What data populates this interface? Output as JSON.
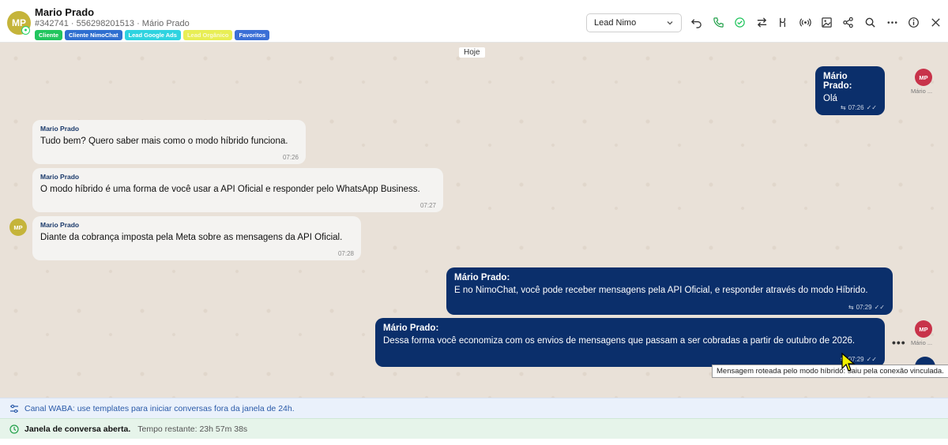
{
  "contact": {
    "initials": "MP",
    "name": "Mario Prado",
    "subtitle": "#342741 · 556298201513 · Mário Prado",
    "tags": [
      {
        "label": "Cliente",
        "color": "#22c55e"
      },
      {
        "label": "Cliente NimoChat",
        "color": "#2f6fd0"
      },
      {
        "label": "Lead Google Ads",
        "color": "#2fd3e0"
      },
      {
        "label": "Lead Orgânico",
        "color": "#e8ee55"
      },
      {
        "label": "Favoritos",
        "color": "#3b6fd6"
      }
    ]
  },
  "toolbar": {
    "lead_select": "Lead Nimo",
    "icons": [
      "undo-icon",
      "phone-icon",
      "check-circle-icon",
      "transfer-icon",
      "pipeline-icon",
      "broadcast-icon",
      "image-icon",
      "share-icon",
      "search-icon",
      "more-icon",
      "info-icon",
      "close-icon"
    ]
  },
  "chat": {
    "day_label": "Hoje",
    "messages": [
      {
        "dir": "out",
        "sender": "Mário Prado:",
        "text": "Olá",
        "time": "07:26"
      },
      {
        "dir": "in",
        "sender": "Mario Prado",
        "text": "Tudo bem? Quero saber mais como o modo híbrido funciona.",
        "time": "07:26"
      },
      {
        "dir": "in",
        "sender": "Mario Prado",
        "text": "O modo híbrido é uma forma de você usar a API Oficial e responder pelo WhatsApp Business.",
        "time": "07:27"
      },
      {
        "dir": "in",
        "sender": "Mario Prado",
        "text": "Diante da cobrança imposta pela Meta sobre as mensagens da API Oficial.",
        "time": "07:28"
      },
      {
        "dir": "out",
        "sender": "Mário Prado:",
        "text": "E no NimoChat, você pode receber mensagens pela API Oficial, e responder através do modo Híbrido.",
        "time": "07:29"
      },
      {
        "dir": "out",
        "sender": "Mário Prado:",
        "text": "Dessa forma você economiza com os envios de mensagens que passam a ser cobradas a partir de outubro de 2026.",
        "time": "07:29"
      }
    ],
    "agent_avatar": {
      "initials": "MP",
      "label": "Mário ...",
      "color": "#c8334a"
    },
    "contact_avatar": {
      "initials": "MP",
      "color": "#c5b43a"
    },
    "tooltip": "Mensagem roteada pelo modo híbrido: saiu pela conexão vinculada."
  },
  "footer": {
    "waba_notice": "Canal WABA: use templates para iniciar conversas fora da janela de 24h.",
    "window_open": "Janela de conversa aberta.",
    "time_left": "Tempo restante: 23h 57m 38s"
  }
}
